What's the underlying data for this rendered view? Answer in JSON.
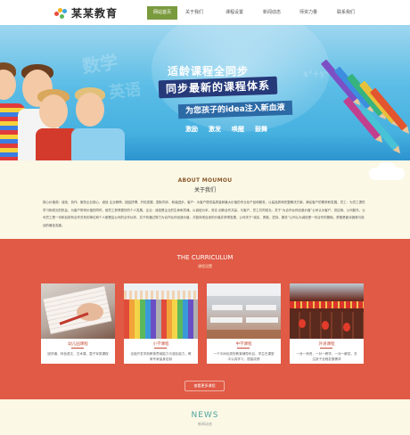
{
  "header": {
    "logo_text": "某某教育",
    "nav": [
      {
        "label": "网站首页",
        "active": true
      },
      {
        "label": "关于我们",
        "active": false
      },
      {
        "label": "课程设置",
        "active": false
      },
      {
        "label": "新闻动态",
        "active": false
      },
      {
        "label": "师资力量",
        "active": false
      },
      {
        "label": "联系我们",
        "active": false
      }
    ]
  },
  "banner": {
    "line1": "适龄课程全同步",
    "line2": "同步最新的课程体系",
    "line3": "为您孩子的idea注入新血液",
    "keywords": [
      "激励",
      "激发",
      "唤醒",
      "鼓舞"
    ],
    "ghost1": "数学",
    "ghost2": "英语"
  },
  "about": {
    "title": "ABOUT MOUMOU",
    "subtitle": "关于我们",
    "body": "核心价值观：诚信、协作、服务企业核心，诚信 企业精神，团结拼搏、开拓发展、国际同步、和谐进步。客户：为客户提供高质量和最大价值的专业化产品和服务，以高品质和完整解决方案，满足客户的需求和发展。员工：为员工提供学习和成长的机会，为客户带来价值的同时，使员工获得更好的个人发展。企业：诚信是企业的生命和灵魂，以诚信为本，务实 创新合作共赢，与客户、员工共同成长。关于“为合作伙伴创造价值”公司认为客户、供应商、公司股东、公司员工是一切和目前有合作关系的单位和个人都是由公司的合作伙伴，并只有通过努力为合作伙伴创造价值，才能体现自身的价值并获得发展，公司关于“诚实、勇敢、坚持、服务”公司认为诚信是一切合作的基础，勇敢是面对困难与挑战的最佳态度。"
  },
  "curriculum": {
    "title": "THE CURRICULUM",
    "subtitle": "课程设置",
    "cards": [
      {
        "title": "幼儿园课程",
        "desc": "固学通、特色语文、艺术课、童子军类课程"
      },
      {
        "title": "小学课程",
        "desc": "全能开发学前教育思维能力与强化能力，教育专家量身定制"
      },
      {
        "title": "中学课程",
        "desc": "一个中间优秀的教育辅导科目，学生在课堂中认真学习，提高成绩"
      },
      {
        "title": "外语课程",
        "desc": "一对一师资，一对一教学，一对一解答，关注孩子全程发展需求"
      }
    ],
    "more_label": "查看更多课程"
  },
  "news": {
    "title": "NEWS",
    "subtitle": "新闻动态"
  },
  "colors": {
    "nav_active": "#7a9a3e",
    "banner_sky": "#5bbde6",
    "about_bg": "#fbf8e6",
    "curriculum_bg": "#e05a46",
    "card_title": "#c24a35",
    "news_title": "#4ea3a0"
  }
}
